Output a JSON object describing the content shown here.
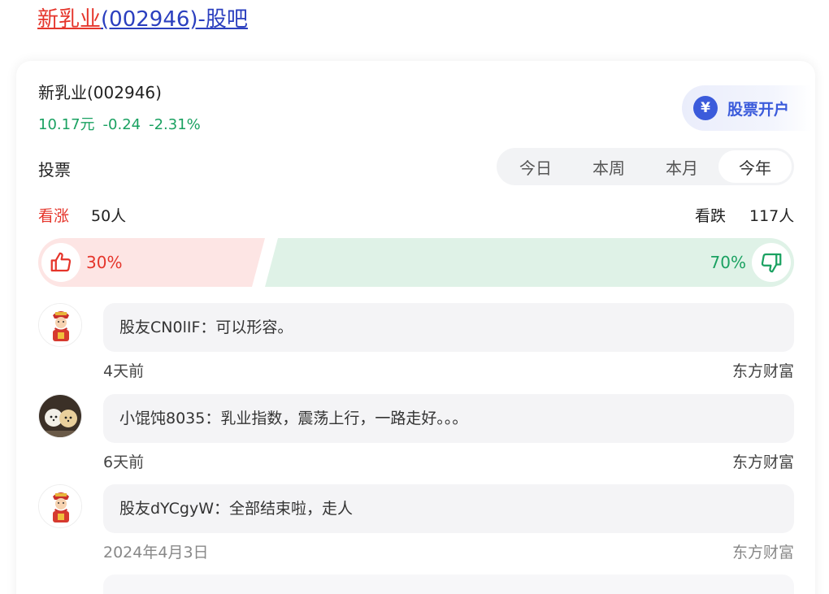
{
  "page_title": {
    "name": "新乳业",
    "rest": "(002946)-股吧"
  },
  "stock": {
    "name": "新乳业(002946)",
    "price": "10.17元",
    "change": "-0.24",
    "change_pct": "-2.31%"
  },
  "open_account": {
    "icon": "yen-icon",
    "icon_glyph": "¥",
    "label": "股票开户"
  },
  "vote": {
    "label": "投票",
    "tabs": [
      {
        "label": "今日",
        "active": false
      },
      {
        "label": "本周",
        "active": false
      },
      {
        "label": "本月",
        "active": false
      },
      {
        "label": "今年",
        "active": true
      }
    ],
    "bull_label": "看涨",
    "bull_count": "50人",
    "bear_label": "看跌",
    "bear_count": "117人",
    "bull_pct": "30%",
    "bear_pct": "70%",
    "bull_fraction": 0.3,
    "colors": {
      "bull": "#e5352b",
      "bear": "#1aa161"
    }
  },
  "comments": [
    {
      "avatar": "caishen-avatar-icon",
      "text": "股友CN0lIF：可以形容。",
      "time": "4天前",
      "source": "东方财富"
    },
    {
      "avatar": "dogs-avatar-icon",
      "text": "小馄饨8035：乳业指数，震荡上行，一路走好。。。",
      "time": "6天前",
      "source": "东方财富"
    },
    {
      "avatar": "caishen-avatar-icon",
      "text": "股友dYCgyW：全部结束啦，走人",
      "time": "2024年4月3日",
      "source": "东方财富"
    }
  ]
}
